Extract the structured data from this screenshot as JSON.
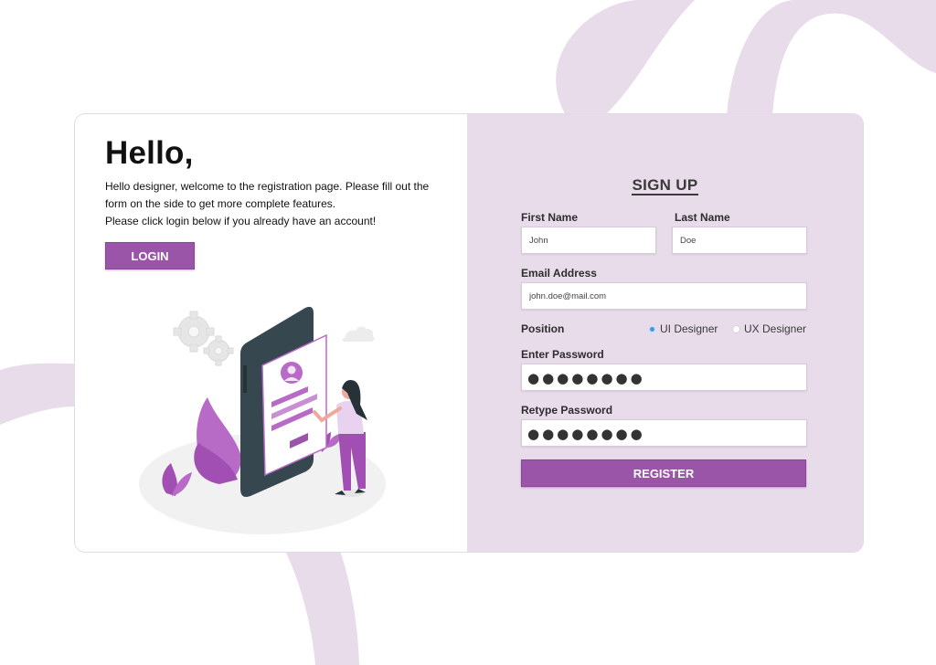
{
  "welcome": {
    "heading": "Hello,",
    "message_line1": "Hello designer, welcome to the registration page. Please fill out the form on the side to get more complete features.",
    "message_line2": "Please click login below if you already have an account!",
    "login_label": "LOGIN"
  },
  "signup": {
    "title": "SIGN UP",
    "first_name": {
      "label": "First Name",
      "value": "John"
    },
    "last_name": {
      "label": "Last Name",
      "value": "Doe"
    },
    "email": {
      "label": "Email Address",
      "value": "john.doe@mail.com"
    },
    "position": {
      "label": "Position",
      "options": [
        "UI Designer",
        "UX Designer"
      ],
      "selected": "UI Designer"
    },
    "password": {
      "label": "Enter Password",
      "masked": "●●●●●●●●"
    },
    "retype_password": {
      "label": "Retype Password",
      "masked": "●●●●●●●●"
    },
    "register_label": "REGISTER"
  },
  "colors": {
    "accent": "#9b55a8",
    "panel": "#e8dcea",
    "radio_selected": "#4a90e2"
  },
  "icons": [
    "gear-icon",
    "cloud-icon",
    "phone-icon",
    "avatar-icon",
    "plant-icon",
    "woman-figure-icon"
  ]
}
